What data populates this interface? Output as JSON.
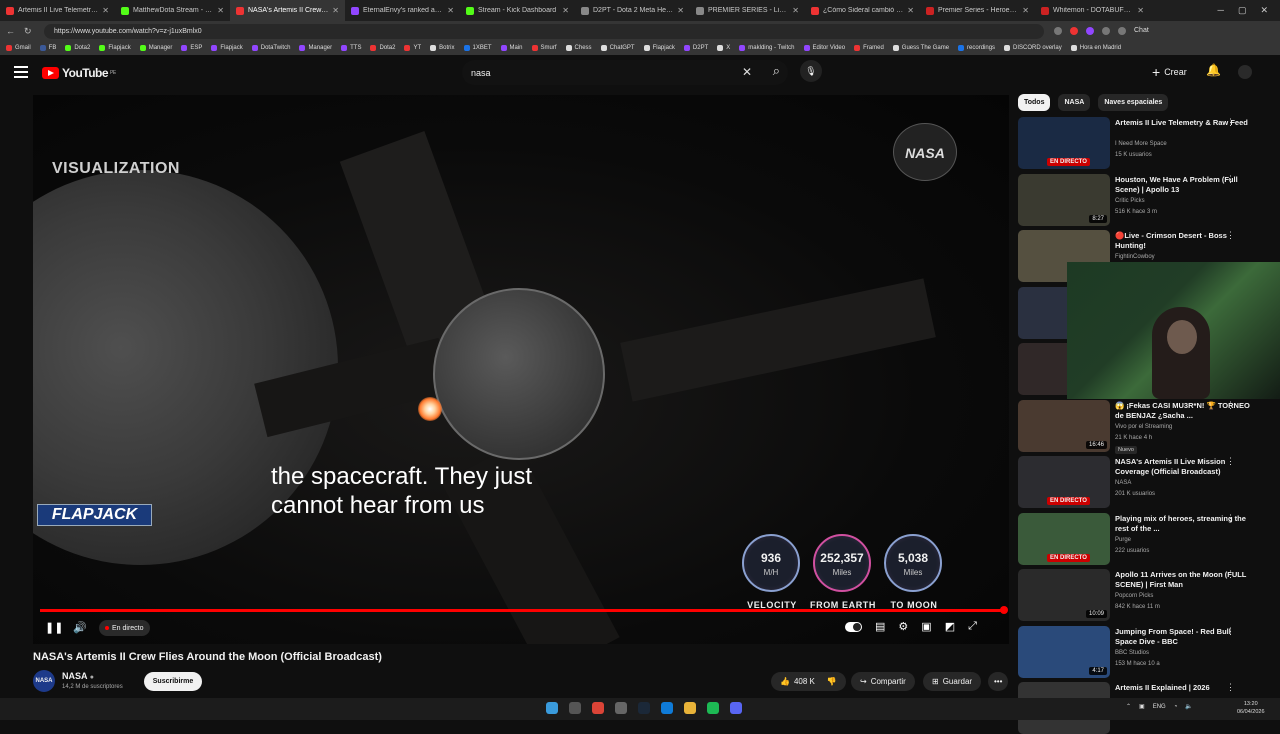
{
  "browser": {
    "tabs": [
      {
        "label": "Artemis II Live Telemetry & Raw",
        "color": "#e33"
      },
      {
        "label": "MatthewDota Stream - Watch Li",
        "color": "#53fc18"
      },
      {
        "label": "NASA's Artemis II Crew Flies",
        "color": "#e33",
        "active": true
      },
      {
        "label": "EternalEnvy's ranked adventure",
        "color": "#9146ff"
      },
      {
        "label": "Stream - Kick Dashboard",
        "color": "#53fc18"
      },
      {
        "label": "D2PT - Dota 2 Meta Heroes 7.4",
        "color": "#888"
      },
      {
        "label": "PREMIER SERIES - Liquipedia Do",
        "color": "#888"
      },
      {
        "label": "¿Cómo Sideral cambió el humo",
        "color": "#e33"
      },
      {
        "label": "Premier Series - Heroes - DOTABU",
        "color": "#c22"
      },
      {
        "label": "Whitemon - DOTABUFF - Dota 2",
        "color": "#c22"
      }
    ],
    "chat_label": "Chat",
    "url": "https://www.youtube.com/watch?v=z-j1uxBmlx0",
    "bookmarks": [
      {
        "label": "Gmail",
        "color": "#e33"
      },
      {
        "label": "FB",
        "color": "#3b5998"
      },
      {
        "label": "Dota2",
        "color": "#53fc18"
      },
      {
        "label": "Flapjack",
        "color": "#53fc18"
      },
      {
        "label": "Manager",
        "color": "#53fc18"
      },
      {
        "label": "ESP",
        "color": "#9146ff"
      },
      {
        "label": "Flapjack",
        "color": "#9146ff"
      },
      {
        "label": "DotaTwitch",
        "color": "#9146ff"
      },
      {
        "label": "Manager",
        "color": "#9146ff"
      },
      {
        "label": "TTS",
        "color": "#9146ff"
      },
      {
        "label": "Dota2",
        "color": "#e33"
      },
      {
        "label": "YT",
        "color": "#e33"
      },
      {
        "label": "Botrix",
        "color": "#ddd"
      },
      {
        "label": "1XBET",
        "color": "#1a73e8"
      },
      {
        "label": "Main",
        "color": "#9146ff"
      },
      {
        "label": "Smurf",
        "color": "#e33"
      },
      {
        "label": "Chess",
        "color": "#ddd"
      },
      {
        "label": "ChatGPT",
        "color": "#ddd"
      },
      {
        "label": "Flapjack",
        "color": "#ddd"
      },
      {
        "label": "D2PT",
        "color": "#9146ff"
      },
      {
        "label": "X",
        "color": "#ddd"
      },
      {
        "label": "maklding - Twitch",
        "color": "#9146ff"
      },
      {
        "label": "Editor Video",
        "color": "#9146ff"
      },
      {
        "label": "Framed",
        "color": "#e33"
      },
      {
        "label": "Guess The Game",
        "color": "#ddd"
      },
      {
        "label": "recordings",
        "color": "#1a73e8"
      },
      {
        "label": "DISCORD overlay",
        "color": "#ddd"
      },
      {
        "label": "Hora en Madrid",
        "color": "#ddd"
      }
    ]
  },
  "youtube": {
    "logo_text": "YouTube",
    "country": "PE",
    "search_value": "nasa",
    "create_label": "Crear"
  },
  "video": {
    "overlay_label": "VISUALIZATION",
    "nasa_logo": "NASA",
    "caption_line1": "the spacecraft. They just",
    "caption_line2": "cannot hear from us",
    "streamer_tag": "FLAPJACK",
    "stats": [
      {
        "value": "936",
        "unit": "M/H",
        "label": "VELOCITY"
      },
      {
        "value": "252,357",
        "unit": "Miles",
        "label": "FROM EARTH"
      },
      {
        "value": "5,038",
        "unit": "Miles",
        "label": "TO MOON"
      }
    ],
    "live_label": "En directo",
    "progress": 1.0,
    "title": "NASA's Artemis II Crew Flies Around the Moon (Official Broadcast)",
    "channel": "NASA",
    "subscribers": "14,2 M de suscriptores",
    "subscribe_label": "Suscribirme",
    "likes": "408 K",
    "share_label": "Compartir",
    "save_label": "Guardar"
  },
  "sidebar": {
    "chips": [
      "Todos",
      "NASA",
      "Naves espaciales"
    ],
    "recommendations": [
      {
        "title": "Artemis II Live Telemetry & Raw Feed",
        "channel": "I Need More Space",
        "meta": "15 K usuarios",
        "badge": "EN DIRECTO",
        "thumb": "#1a2a44"
      },
      {
        "title": "Houston, We Have A Problem (Full Scene) | Apollo 13",
        "channel": "Critic Picks",
        "meta": "516 K hace 3 m",
        "duration": "8:27",
        "thumb": "#3a3a30"
      },
      {
        "title": "🔴Live - Crimson Desert - Boss Hunting!",
        "channel": "FightinCowboy",
        "meta": "",
        "thumb": "#555040"
      },
      {
        "title": "",
        "channel": "",
        "meta": "",
        "thumb": "#2a3040"
      },
      {
        "title": "",
        "channel": "",
        "meta": "",
        "thumb": "#302828"
      },
      {
        "title": "😱 ¡Fekas CASI MU3R*N! 🏆 TORNEO de BENJAZ ¿Sacha ...",
        "channel": "Vivo por el Streaming",
        "meta": "21 K hace 4 h",
        "duration": "16:46",
        "new": "Nuevo",
        "thumb": "#4a3a30"
      },
      {
        "title": "NASA's Artemis II Live Mission Coverage (Official Broadcast)",
        "channel": "NASA",
        "meta": "201 K usuarios",
        "badge": "EN DIRECTO",
        "thumb": "#2c2c30"
      },
      {
        "title": "Playing mix of heroes, streaming the rest of the ...",
        "channel": "Purge",
        "meta": "222 usuarios",
        "badge": "EN DIRECTO",
        "thumb": "#3a5a3a"
      },
      {
        "title": "Apollo 11 Arrives on the Moon (FULL SCENE) | First Man",
        "channel": "Popcorn Picks",
        "meta": "842 K hace 11 m",
        "duration": "10:09",
        "thumb": "#2a2a2a"
      },
      {
        "title": "Jumping From Space! - Red Bull Space Dive - BBC",
        "channel": "BBC Studios",
        "meta": "153 M hace 10 a",
        "duration": "4:17",
        "thumb": "#2a4a7a"
      },
      {
        "title": "Artemis II Explained | 2026",
        "channel": "",
        "meta": "",
        "thumb": "#333"
      }
    ]
  },
  "taskbar": {
    "lang": "ENG",
    "time": "13:20",
    "date": "06/04/2026"
  }
}
